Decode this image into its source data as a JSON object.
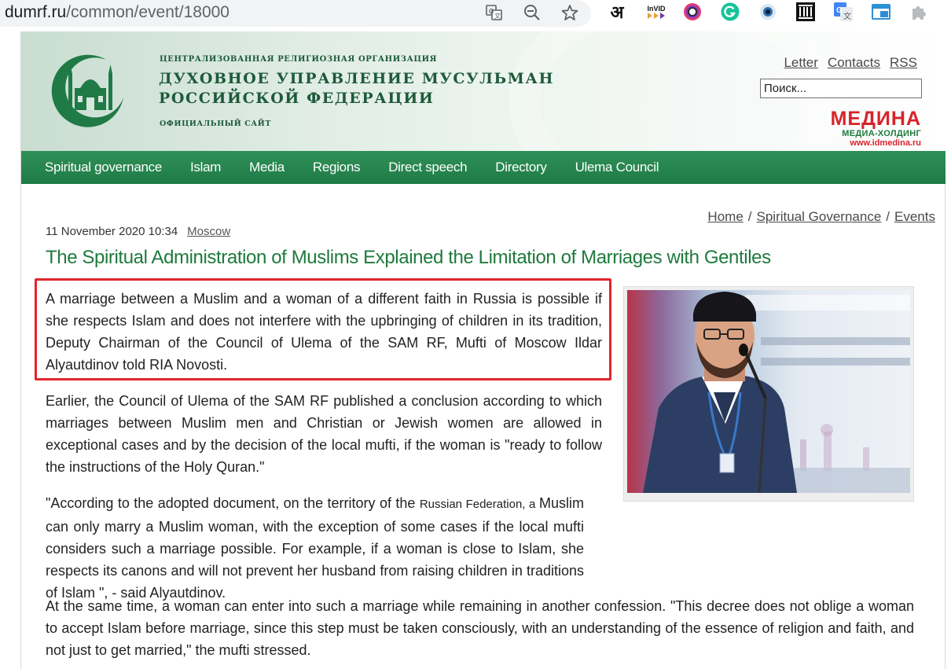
{
  "browser": {
    "url_domain": "dumrf.ru",
    "url_path": "/common/event/18000",
    "ext_invid_label": "InVID",
    "ext_hindi_label": "अ"
  },
  "header": {
    "org_small": "Централизованная религиозная организация",
    "org_title_line1": "Духовное управление мусульман",
    "org_title_line2": "Российской Федерации",
    "org_sub": "Официальный сайт",
    "links": {
      "letter": "Letter",
      "contacts": "Contacts",
      "rss": "RSS"
    },
    "search_placeholder": "Поиск...",
    "medina": {
      "name": "МЕДИНА",
      "tagline": "МЕДИА-ХОЛДИНГ",
      "url": "www.idmedina.ru"
    }
  },
  "nav": {
    "items": [
      "Spiritual governance",
      "Islam",
      "Media",
      "Regions",
      "Direct speech",
      "Directory",
      "Ulema Council"
    ]
  },
  "breadcrumb": {
    "home": "Home",
    "section": "Spiritual Governance",
    "current": "Events",
    "separator": "/"
  },
  "article": {
    "date": "11 November 2020 10:34",
    "location": "Moscow",
    "title": "The Spiritual Administration of Muslims Explained the Limitation of Marriages with Gentiles",
    "p1": "A marriage between a Muslim and a woman of a different faith in Russia is possible if she respects Islam and does not interfere with the upbringing of children in its tradition, Deputy Chairman of the Council of Ulema of the SAM RF, Mufti of Moscow Ildar Alyautdinov told RIA Novosti.",
    "p2": "Earlier, the Council of Ulema of the SAM RF published a conclusion according to which marriages between Muslim men and Christian or Jewish women are allowed in exceptional cases and by the decision of the local mufti, if the woman is \"ready to follow the instructions of the Holy Quran.\"",
    "p3_a": "\"According to the adopted document, on the territory of the ",
    "p3_b": "Russian Federation",
    "p3_c": ", a ",
    "p3_d": "Muslim can only marry a Muslim woman, with the exception of some cases if the local mufti considers such a marriage possible. For example, if a woman is close to Islam, she respects its canons and will not prevent her husband from raising children in traditions of Islam \", - said Alyautdinov.",
    "p4": "At the same time, a woman can enter into such a marriage while remaining in another confession. \"This decree does not oblige a woman to accept Islam before marriage, since this step must be taken consciously, with an understanding of the essence of religion and faith, and not just to get married,\" the mufti stressed."
  },
  "colors": {
    "brand_green": "#1e7a3c",
    "nav_green": "#2f9158",
    "highlight_red": "#e0262d",
    "medina_red": "#d8232a"
  },
  "icons": [
    "translate-icon",
    "zoom-out-icon",
    "star-icon",
    "hindi-ext-icon",
    "invid-ext-icon",
    "color-ext-icon",
    "grammarly-icon",
    "eye-ext-icon",
    "archive-icon",
    "google-translate-icon",
    "window-ext-icon",
    "puzzle-icon"
  ]
}
